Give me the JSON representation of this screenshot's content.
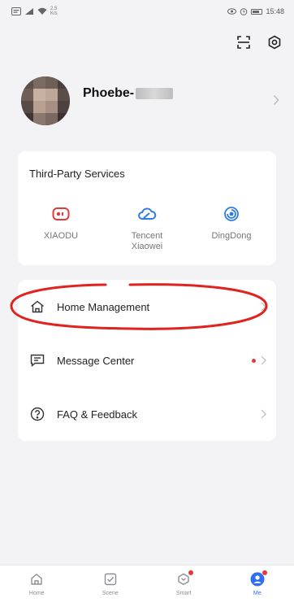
{
  "status_bar": {
    "speed": "2.5\nK/s",
    "time": "15:48",
    "battery": "100"
  },
  "profile": {
    "name": "Phoebe-"
  },
  "third_party": {
    "title": "Third-Party Services",
    "items": [
      {
        "label": "XIAODU",
        "icon": "xiaodu-icon",
        "color": "#e5383b"
      },
      {
        "label": "Tencent\nXiaowei",
        "icon": "tencent-cloud-icon",
        "color": "#2f7de1"
      },
      {
        "label": "DingDong",
        "icon": "dingdong-icon",
        "color": "#2f7de1"
      }
    ]
  },
  "menu": [
    {
      "label": "Home Management",
      "icon": "home-icon"
    },
    {
      "label": "Message Center",
      "icon": "message-icon"
    },
    {
      "label": "FAQ & Feedback",
      "icon": "help-icon"
    }
  ],
  "tabs": [
    {
      "label": "Home"
    },
    {
      "label": "Scene"
    },
    {
      "label": "Smart"
    },
    {
      "label": "Me"
    }
  ],
  "colors": {
    "accent": "#2f6ef2",
    "highlight": "#e0231f",
    "notification": "#e5383b"
  }
}
